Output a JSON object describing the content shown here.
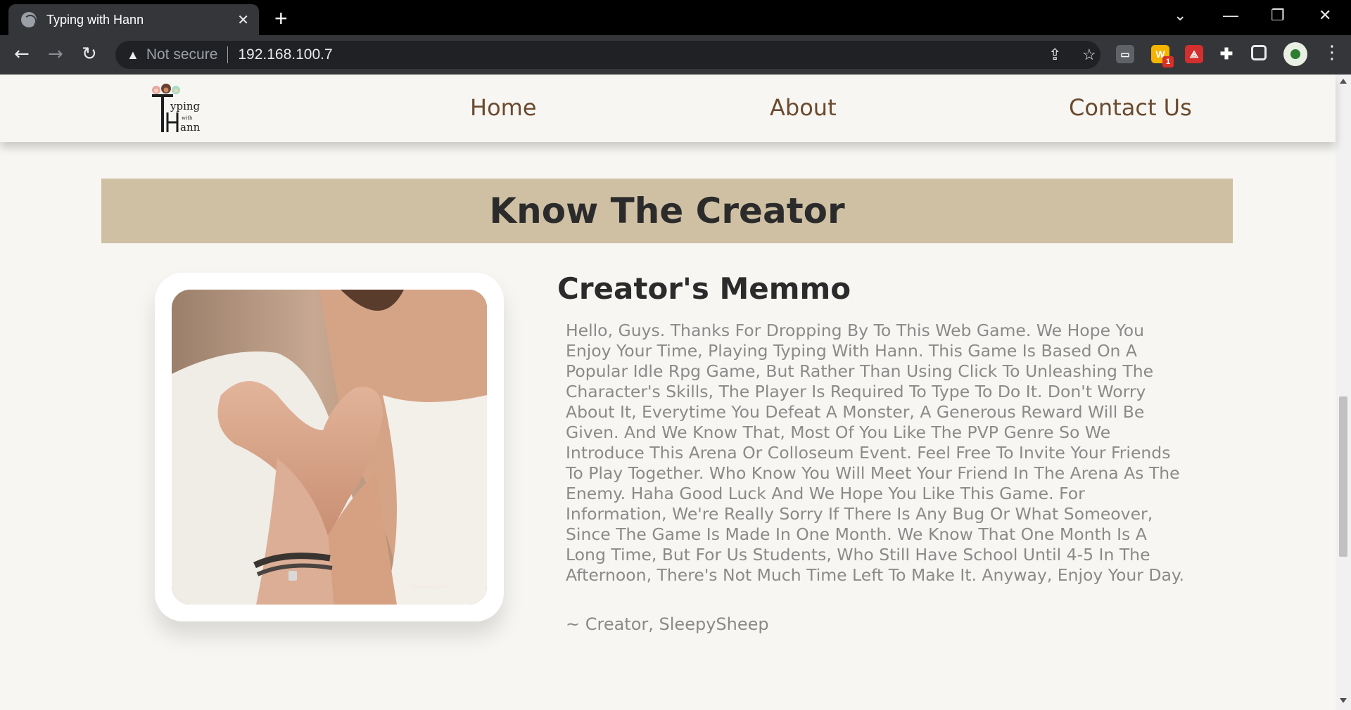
{
  "browser": {
    "tab_title": "Typing with Hann",
    "security_label": "Not secure",
    "url": "192.168.100.7",
    "extension_badge": "1"
  },
  "site": {
    "nav": {
      "home": "Home",
      "about": "About",
      "contact": "Contact Us"
    },
    "logo_text": "Typing with Hann"
  },
  "section": {
    "banner_title": "Know The Creator",
    "memo_title": "Creator's Memmo",
    "memo_body": "Hello, Guys. Thanks For Dropping By To This Web Game. We Hope You Enjoy Your Time, Playing Typing With Hann. This Game Is Based On A Popular Idle Rpg Game, But Rather Than Using Click To Unleashing The Character's Skills, The Player Is Required To Type To Do It. Don't Worry About It, Everytime You Defeat A Monster, A Generous Reward Will Be Given. And We Know That, Most Of You Like The PVP Genre So We Introduce This Arena Or Colloseum Event. Feel Free To Invite Your Friends To Play Together. Who Know You Will Meet Your Friend In The Arena As The Enemy. Haha Good Luck And We Hope You Like This Game. For Information, We're Really Sorry If There Is Any Bug Or What Someover, Since The Game Is Made In One Month. We Know That One Month Is A Long Time, But For Us Students, Who Still Have School Until 4-5 In The Afternoon, There's Not Much Time Left To Make It. Anyway, Enjoy Your Day.",
    "memo_signature": "~ Creator, SleepySheep"
  },
  "colors": {
    "banner_bg": "#cfc0a4",
    "nav_link": "#6b4a2f",
    "page_bg": "#f7f6f2"
  }
}
